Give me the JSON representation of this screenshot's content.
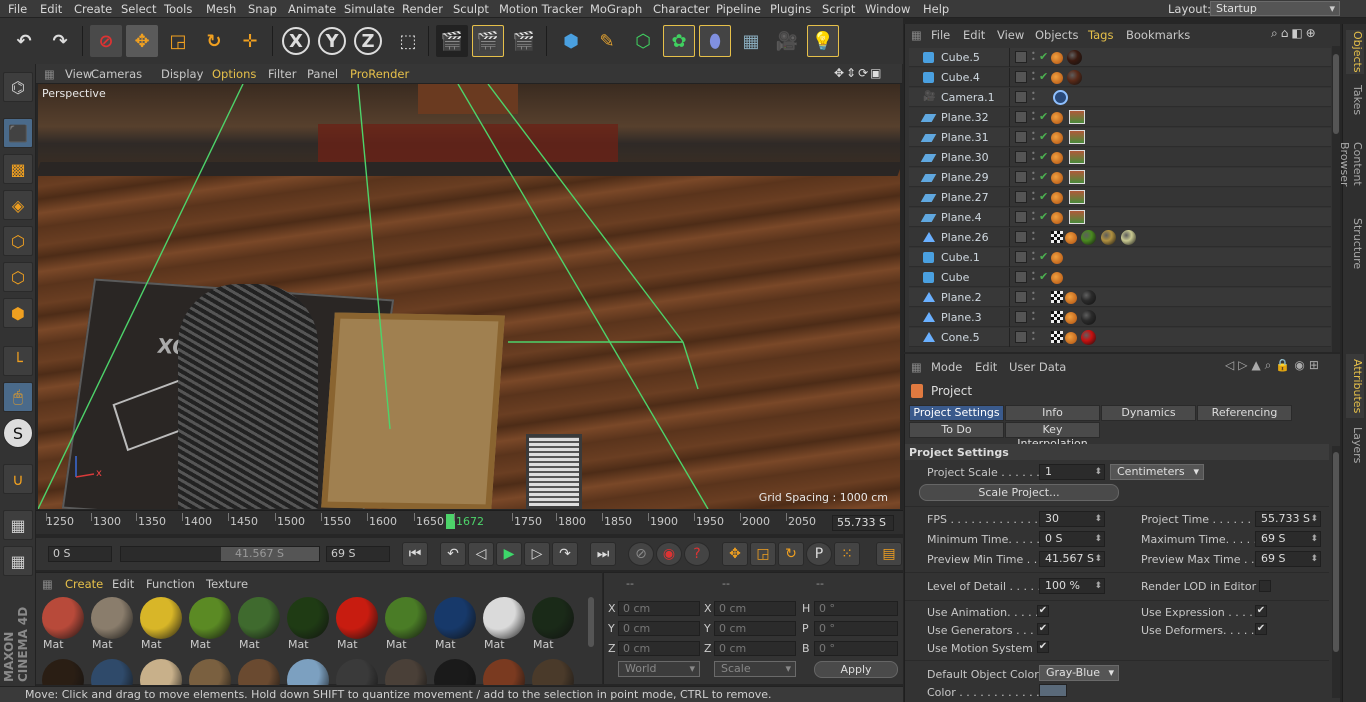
{
  "menubar": {
    "items": [
      "File",
      "Edit",
      "Create",
      "Select",
      "Tools",
      "Mesh",
      "Snap",
      "Animate",
      "Simulate",
      "Render",
      "Sculpt",
      "Motion Tracker",
      "MoGraph",
      "Character",
      "Pipeline",
      "Plugins",
      "Script",
      "Window",
      "Help"
    ],
    "layout_label": "Layout:",
    "layout_value": "Startup"
  },
  "toolbar": {
    "axis_x": "X",
    "axis_y": "Y",
    "axis_z": "Z"
  },
  "viewport": {
    "menu": [
      "View",
      "Cameras",
      "Display",
      "Options",
      "Filter",
      "Panel",
      "ProRender"
    ],
    "label": "Perspective",
    "grid_spacing": "Grid Spacing : 1000 cm",
    "book_text": "SKOLIOX",
    "axis_x": "x"
  },
  "timeline": {
    "ticks": [
      "1250",
      "1300",
      "1350",
      "1400",
      "1450",
      "1500",
      "1550",
      "1600",
      "1650",
      "1672",
      "1750",
      "1800",
      "1850",
      "1900",
      "1950",
      "2000",
      "2050"
    ],
    "current_frame": "1672",
    "current_time": "55.733 S"
  },
  "transport": {
    "start": "0 S",
    "preview_start": "41.567 S",
    "end": "69 S"
  },
  "materials": {
    "menu": [
      "Create",
      "Edit",
      "Function",
      "Texture"
    ],
    "row1": [
      {
        "label": "Mat",
        "color": "#b84a3a"
      },
      {
        "label": "Mat",
        "color": "#8a7d6c"
      },
      {
        "label": "Mat",
        "color": "#d8b628"
      },
      {
        "label": "Mat",
        "color": "#5b8a24"
      },
      {
        "label": "Mat",
        "color": "#3f6a2e"
      },
      {
        "label": "Mat",
        "color": "#1f3b14"
      },
      {
        "label": "Mat",
        "color": "#c81c10"
      },
      {
        "label": "Mat",
        "color": "#4a7c26"
      },
      {
        "label": "Mat",
        "color": "#17396a"
      },
      {
        "label": "Mat",
        "color": "#dadada"
      },
      {
        "label": "Mat",
        "color": "#1a2a18"
      }
    ],
    "row2": [
      "#2a1e14",
      "#2f4a6a",
      "#c8b08a",
      "#7a6040",
      "#6a4a30",
      "#7ca0c0",
      "#3a3a3a",
      "#4a4038",
      "#1a1a1a",
      "#7a3a20",
      "#4a3a2a"
    ]
  },
  "coordinates": {
    "headers": [
      "--",
      "--",
      "--"
    ],
    "rows": [
      {
        "a": "X",
        "av": "0 cm",
        "b": "X",
        "bv": "0 cm",
        "c": "H",
        "cv": "0 °"
      },
      {
        "a": "Y",
        "av": "0 cm",
        "b": "Y",
        "bv": "0 cm",
        "c": "P",
        "cv": "0 °"
      },
      {
        "a": "Z",
        "av": "0 cm",
        "b": "Z",
        "bv": "0 cm",
        "c": "B",
        "cv": "0 °"
      }
    ],
    "space": "World",
    "mode": "Scale",
    "apply": "Apply"
  },
  "status": "Move: Click and drag to move elements. Hold down SHIFT to quantize movement / add to the selection in point mode, CTRL to remove.",
  "brand": {
    "line1": "MAXON",
    "line2": "CINEMA 4D"
  },
  "objects": {
    "menu": [
      "File",
      "Edit",
      "View",
      "Objects",
      "Tags",
      "Bookmarks"
    ],
    "rows": [
      {
        "name": "Cube.5",
        "type": "cube",
        "check": true,
        "tags": [
          "#3a1a10"
        ]
      },
      {
        "name": "Cube.4",
        "type": "cube",
        "check": true,
        "tags": [
          "#5a2a18"
        ]
      },
      {
        "name": "Camera.1",
        "type": "camera",
        "check": false,
        "tags": [
          "target"
        ]
      },
      {
        "name": "Plane.32",
        "type": "plane",
        "check": true,
        "tags": [
          "tex"
        ]
      },
      {
        "name": "Plane.31",
        "type": "plane",
        "check": true,
        "tags": [
          "tex"
        ]
      },
      {
        "name": "Plane.30",
        "type": "plane",
        "check": true,
        "tags": [
          "tex"
        ]
      },
      {
        "name": "Plane.29",
        "type": "plane",
        "check": true,
        "tags": [
          "tex"
        ]
      },
      {
        "name": "Plane.27",
        "type": "plane",
        "check": true,
        "tags": [
          "tex"
        ]
      },
      {
        "name": "Plane.4",
        "type": "plane",
        "check": true,
        "tags": [
          "tex"
        ]
      },
      {
        "name": "Plane.26",
        "type": "cloner",
        "check": false,
        "tags": [
          "checker",
          "#4a8a20",
          "#b09040",
          "#c8c890"
        ]
      },
      {
        "name": "Cube.1",
        "type": "cube",
        "check": true,
        "tags": []
      },
      {
        "name": "Cube",
        "type": "cube",
        "check": true,
        "tags": []
      },
      {
        "name": "Plane.2",
        "type": "cloner",
        "check": false,
        "tags": [
          "checker",
          "#2a2a2a"
        ]
      },
      {
        "name": "Plane.3",
        "type": "cloner",
        "check": false,
        "tags": [
          "checker",
          "#2a2a2a"
        ]
      },
      {
        "name": "Cone.5",
        "type": "cloner",
        "check": false,
        "tags": [
          "checker",
          "#c81010"
        ]
      }
    ]
  },
  "right_tabs": [
    "Objects",
    "Takes",
    "Content Browser",
    "Structure",
    "Attributes",
    "Layers"
  ],
  "attributes": {
    "menu": [
      "Mode",
      "Edit",
      "User Data"
    ],
    "title": "Project",
    "tabs1": [
      "Project Settings",
      "Info",
      "Dynamics",
      "Referencing"
    ],
    "tabs2": [
      "To Do",
      "Key Interpolation"
    ],
    "section": "Project Settings",
    "project_scale_label": "Project Scale . . . . . .",
    "project_scale_value": "1",
    "project_scale_unit": "Centimeters",
    "scale_button": "Scale Project...",
    "fps_label": "FPS . . . . . . . . . . . . . .",
    "fps_value": "30",
    "project_time_label": "Project Time . . . . . . .",
    "project_time_value": "55.733 S",
    "min_time_label": "Minimum Time. . . . . . .",
    "min_time_value": "0 S",
    "max_time_label": "Maximum Time. . . . . .",
    "max_time_value": "69 S",
    "prev_min_label": "Preview Min Time . . .",
    "prev_min_value": "41.567 S",
    "prev_max_label": "Preview Max Time . . .",
    "prev_max_value": "69 S",
    "lod_label": "Level of Detail . . . . .",
    "lod_value": "100 %",
    "render_lod_label": "Render LOD in Editor",
    "use_anim_label": "Use Animation. . . . .",
    "use_expr_label": "Use Expression . . . . .",
    "use_gen_label": "Use Generators . . . .",
    "use_def_label": "Use Deformers. . . . . .",
    "use_motion_label": "Use Motion System",
    "default_color_label": "Default Object Color",
    "default_color_value": "Gray-Blue",
    "color_label": "Color . . . . . . . . . . . ."
  }
}
